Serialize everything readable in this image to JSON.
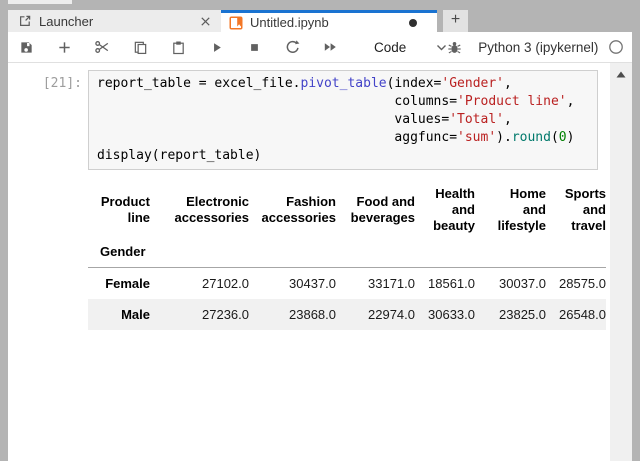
{
  "tab_bar": {
    "launcher_tab": {
      "label": "Launcher"
    },
    "notebook_tab": {
      "label": "Untitled.ipynb",
      "unsaved": true
    },
    "new_tab_label": "+"
  },
  "toolbar": {
    "cell_type_value": "Code",
    "kernel_name": "Python 3 (ipykernel)"
  },
  "icons": [
    "launcher-icon",
    "close-icon",
    "notebook-icon",
    "save-icon",
    "add-cell-icon",
    "cut-icon",
    "copy-icon",
    "paste-icon",
    "run-icon",
    "stop-icon",
    "restart-icon",
    "fast-forward-icon",
    "chevron-down-icon",
    "debugger-bug-icon",
    "kernel-status-circle-icon",
    "scroll-up-arrow-icon"
  ],
  "cell": {
    "prompt": "[21]:",
    "code_lines": [
      [
        {
          "t": "report_table = excel_file.",
          "c": "plain"
        },
        {
          "t": "pivot_table",
          "c": "func"
        },
        {
          "t": "(index=",
          "c": "plain"
        },
        {
          "t": "'Gender'",
          "c": "str"
        },
        {
          "t": ",",
          "c": "plain"
        }
      ],
      [
        {
          "t": "                                      columns=",
          "c": "plain"
        },
        {
          "t": "'Product line'",
          "c": "str"
        },
        {
          "t": ",",
          "c": "plain"
        }
      ],
      [
        {
          "t": "                                      values=",
          "c": "plain"
        },
        {
          "t": "'Total'",
          "c": "str"
        },
        {
          "t": ",",
          "c": "plain"
        }
      ],
      [
        {
          "t": "                                      aggfunc=",
          "c": "plain"
        },
        {
          "t": "'sum'",
          "c": "str"
        },
        {
          "t": ").",
          "c": "plain"
        },
        {
          "t": "round",
          "c": "builtin"
        },
        {
          "t": "(",
          "c": "plain"
        },
        {
          "t": "0",
          "c": "num"
        },
        {
          "t": ")",
          "c": "plain"
        }
      ],
      [
        {
          "t": "display(report_table)",
          "c": "plain"
        }
      ]
    ]
  },
  "output_table": {
    "columns_name": "Product line",
    "index_name": "Gender",
    "columns": [
      "Electronic accessories",
      "Fashion accessories",
      "Food and beverages",
      "Health and beauty",
      "Home and lifestyle",
      "Sports and travel"
    ],
    "rows": [
      {
        "index": "Female",
        "values": [
          "27102.0",
          "30437.0",
          "33171.0",
          "18561.0",
          "30037.0",
          "28575.0"
        ]
      },
      {
        "index": "Male",
        "values": [
          "27236.0",
          "23868.0",
          "22974.0",
          "30633.0",
          "23825.0",
          "26548.0"
        ]
      }
    ]
  },
  "colors": {
    "window_chrome": "#b4b4b4",
    "active_tab_accent": "#1a73d1",
    "notebook_icon_orange": "#f37726",
    "toolbar_icon": "#616161",
    "string_token": "#ba2121",
    "function_token": "#4343c8",
    "builtin_token": "#00796b",
    "number_token": "#008000",
    "stripe_row": "#f1f1f1"
  }
}
